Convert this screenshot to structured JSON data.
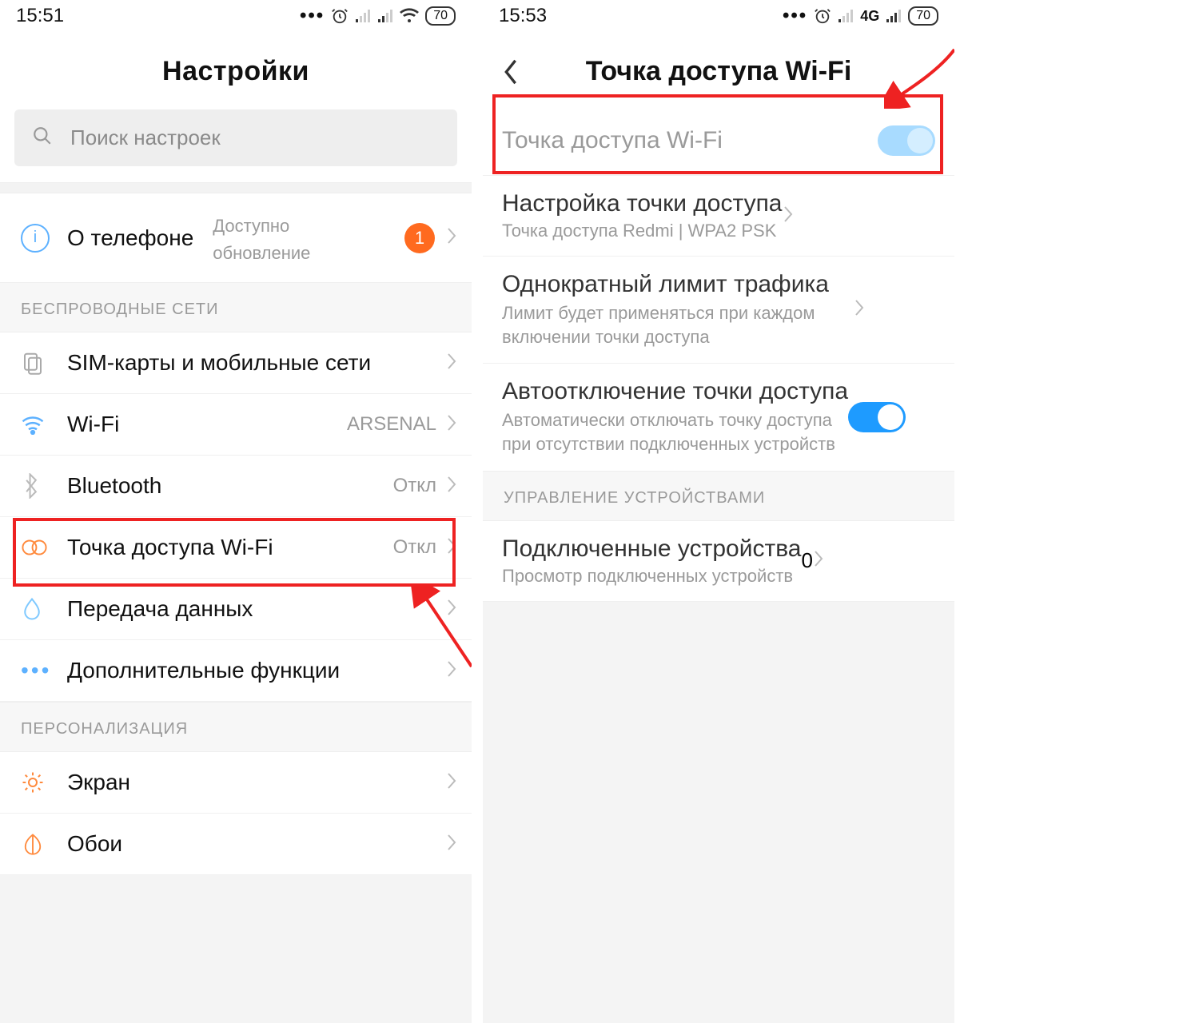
{
  "left": {
    "status": {
      "time": "15:51",
      "battery": "70"
    },
    "title": "Настройки",
    "search_placeholder": "Поиск настроек",
    "about": {
      "label": "О телефоне",
      "sub1": "Доступно",
      "sub2": "обновление",
      "badge": "1"
    },
    "sections": {
      "wireless": "БЕСПРОВОДНЫЕ СЕТИ",
      "personal": "ПЕРСОНАЛИЗАЦИЯ"
    },
    "rows": {
      "sim": "SIM-карты и мобильные сети",
      "wifi": {
        "label": "Wi-Fi",
        "value": "ARSENAL"
      },
      "bt": {
        "label": "Bluetooth",
        "value": "Откл"
      },
      "hotspot": {
        "label": "Точка доступа Wi-Fi",
        "value": "Откл"
      },
      "data": "Передача данных",
      "more": "Дополнительные функции",
      "screen": "Экран",
      "wallpaper": "Обои"
    }
  },
  "right": {
    "status": {
      "time": "15:53",
      "net": "4G",
      "battery": "70"
    },
    "title": "Точка доступа Wi-Fi",
    "toggle_label": "Точка доступа Wi-Fi",
    "setup": {
      "label": "Настройка точки доступа",
      "sub": "Точка доступа Redmi | WPA2 PSK"
    },
    "limit": {
      "label": "Однократный лимит трафика",
      "sub": "Лимит будет применяться при каждом включении точки доступа"
    },
    "auto_off": {
      "label": "Автоотключение точки доступа",
      "sub": "Автоматически отключать точку доступа при отсутствии подключенных устройств"
    },
    "section_devices": "УПРАВЛЕНИЕ УСТРОЙСТВАМИ",
    "connected": {
      "label": "Подключенные устройства",
      "sub": "Просмотр подключенных устройств",
      "count": "0"
    }
  }
}
